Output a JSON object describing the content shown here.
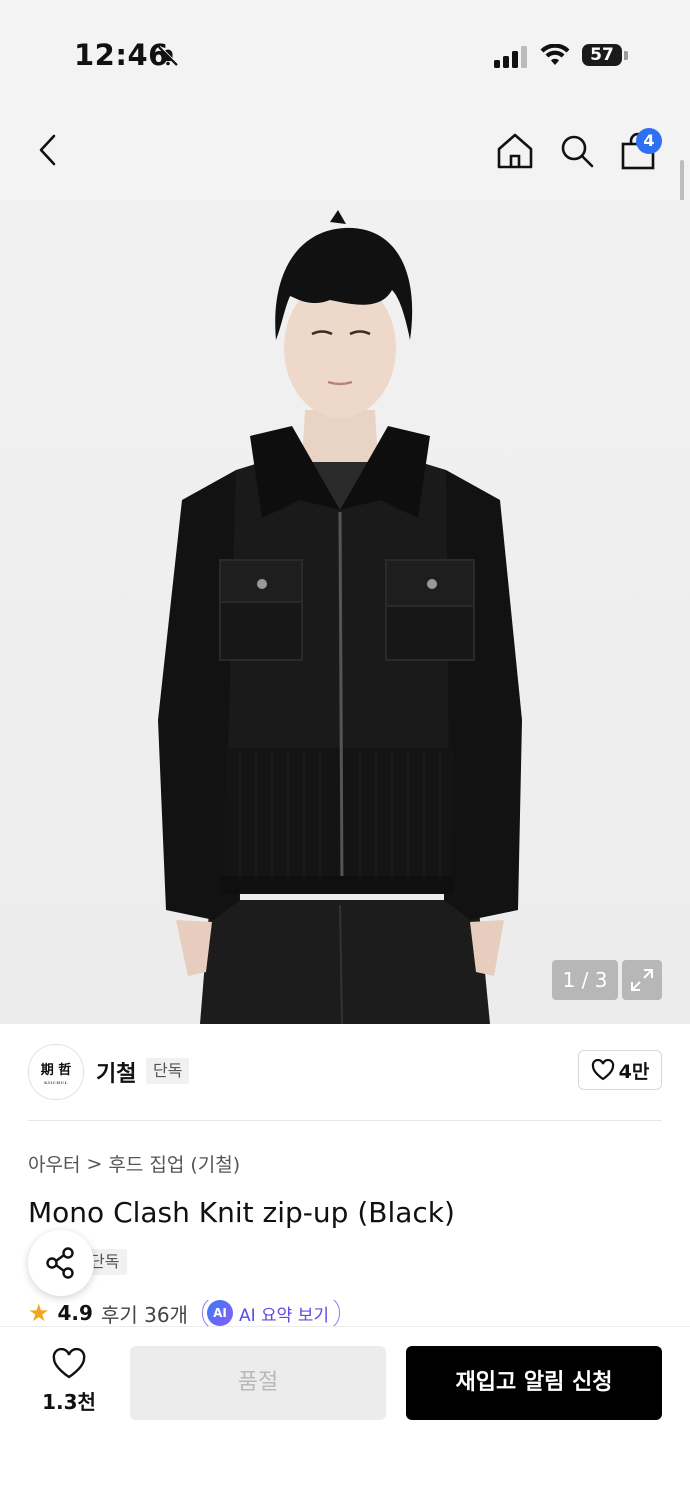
{
  "status_bar": {
    "time": "12:46",
    "battery": "57"
  },
  "header": {
    "cart_count": "4"
  },
  "gallery": {
    "counter": "1 / 3"
  },
  "brand": {
    "logo_text": "期 哲",
    "logo_sub": "KIICHUL",
    "name": "기철",
    "exclusive_tag": "단독",
    "likes": "4만"
  },
  "product": {
    "breadcrumb_category": "아우터",
    "breadcrumb_separator": ">",
    "breadcrumb_sub": "후드 집업 (기철)",
    "title": "Mono Clash Knit zip-up (Black)",
    "exclusive_tag": "단독",
    "rating": "4.9",
    "reviews": "후기 36개",
    "ai_badge": "AI",
    "ai_summary_label": "AI 요약 보기"
  },
  "bottom": {
    "wish_count": "1.3천",
    "soldout_label": "품절",
    "restock_label": "재입고 알림 신청"
  },
  "colors": {
    "accent_blue": "#2f6ff2",
    "star": "#f3a51e",
    "cta_bg": "#000000"
  }
}
